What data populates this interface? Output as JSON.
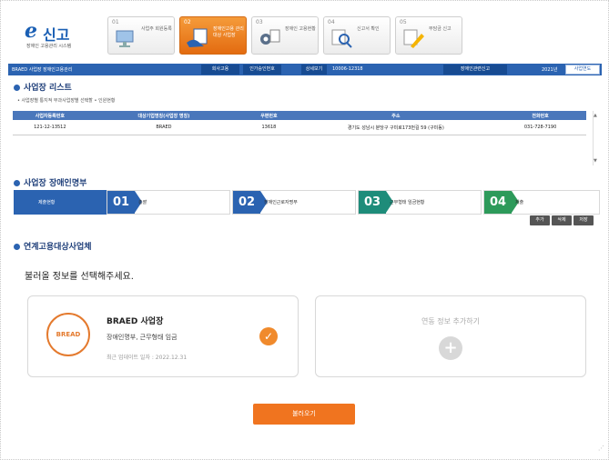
{
  "header": {
    "logo_mark": "e",
    "logo_text": "신고",
    "logo_sub": "장애인 고용관리 시스템",
    "steps": [
      {
        "num": "01",
        "label": "사업주 회원등록",
        "icon": "monitor-icon",
        "active": false
      },
      {
        "num": "02",
        "label": "장애인고용 관리대상 사업장",
        "icon": "hand-document-icon",
        "active": true
      },
      {
        "num": "03",
        "label": "장애인 고용현황",
        "icon": "gear-document-icon",
        "active": false
      },
      {
        "num": "04",
        "label": "신고서 확인",
        "icon": "magnifier-icon",
        "active": false
      },
      {
        "num": "05",
        "label": "부담금 신고",
        "icon": "pen-icon",
        "active": false
      }
    ]
  },
  "infobar": {
    "company": "BRAED 사업장 장애인고용관리",
    "btn1": "회사고용",
    "btn2": "인가승인번호",
    "btn3": "상세보기",
    "field": "10006-12318",
    "btn4": "장애인관련신고",
    "year": "2021년",
    "btn5": "사업연도"
  },
  "section1": {
    "title": "사업장 리스트",
    "hint": "• 사업장별 통지적 부과사업장별 선택할 • 인원현황",
    "columns": [
      "사업자등록번호",
      "대상기업명칭(사업장 명칭)",
      "우편번호",
      "주소",
      "전화번호"
    ],
    "rows": [
      [
        "121-12-13512",
        "BRAED",
        "13618",
        "경기도 성남시 분당구 구미로173번길 59 (구미동)",
        "031-728-7190"
      ]
    ]
  },
  "section2": {
    "title": "사업장 장애인명부",
    "tabs": [
      {
        "num": "01",
        "label": "총괄",
        "color": "#2b63b1"
      },
      {
        "num": "02",
        "label": "장애인근로자명부",
        "color": "#2b63b1"
      },
      {
        "num": "03",
        "label": "근무형태 임금현황",
        "color": "#1e8c7a"
      },
      {
        "num": "04",
        "label": "제출",
        "color": "#2d9a5a"
      }
    ],
    "first_tab_label": "제출현황",
    "small_buttons": [
      "추가",
      "삭제",
      "저장"
    ]
  },
  "section3": {
    "title": "연계고용대상사업체",
    "prompt": "불러올 정보를 선택해주세요.",
    "card": {
      "logo": "BREAD",
      "name": "BRAED 사업장",
      "desc": "장애인명부, 근무형태 임금",
      "date": "최근 업데이트 일자 : 2022.12.31"
    },
    "add_card_text": "연동 정보 추가하기",
    "submit_button": "불러오기"
  }
}
